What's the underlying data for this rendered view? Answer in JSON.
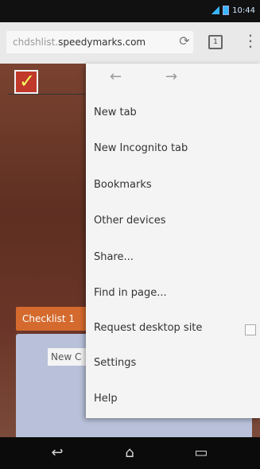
{
  "statusbar": {
    "time": "10:44"
  },
  "browser": {
    "url_scheme": "chdshlist.",
    "url_host": "speedymarks.com",
    "reload_icon": "reload-icon",
    "tabs_icon": "tabs-icon",
    "menu_icon": "overflow-menu-icon"
  },
  "page": {
    "checklist_tab": "Checklist 1",
    "input_placeholder": "New C"
  },
  "menu": {
    "back_icon": "arrow-left-icon",
    "forward_icon": "arrow-right-icon",
    "items": [
      {
        "label": "New tab"
      },
      {
        "label": "New Incognito tab"
      },
      {
        "label": "Bookmarks"
      },
      {
        "label": "Other devices"
      },
      {
        "label": "Share..."
      },
      {
        "label": "Find in page..."
      },
      {
        "label": "Request desktop site"
      },
      {
        "label": "Settings"
      },
      {
        "label": "Help"
      }
    ]
  },
  "navbar": {
    "back_icon": "nav-back-icon",
    "home_icon": "nav-home-icon",
    "recents_icon": "nav-recents-icon"
  },
  "colors": {
    "accent_blue": "#5aa7d6",
    "tab_orange": "#d46a2e",
    "menu_bg": "#f4f4f4"
  }
}
